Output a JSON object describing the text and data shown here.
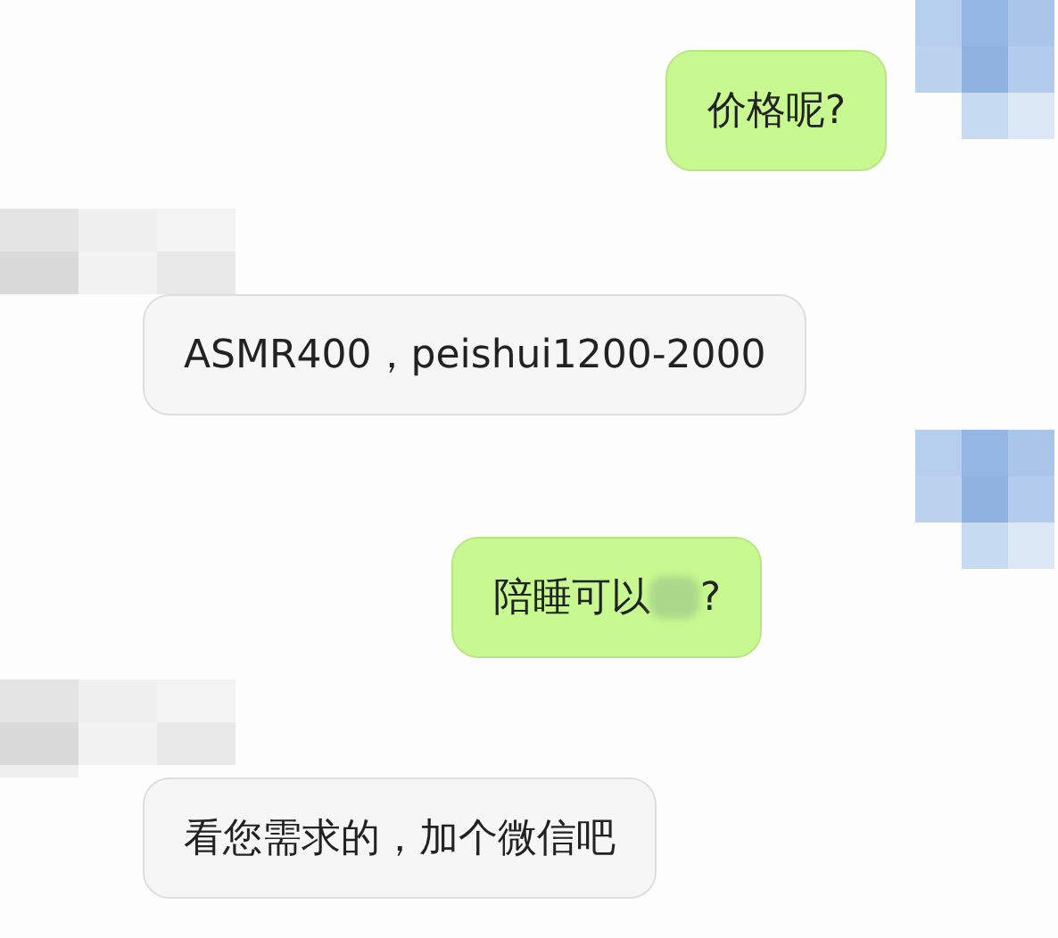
{
  "messages": [
    {
      "kind": "outgoing",
      "parts": [
        {
          "kind": "text",
          "text": "价格呢?"
        }
      ]
    },
    {
      "kind": "incoming",
      "parts": [
        {
          "kind": "text",
          "text": "ASMR400，peishui1200-2000"
        }
      ]
    },
    {
      "kind": "outgoing",
      "parts": [
        {
          "kind": "text",
          "text": "陪睡可以"
        },
        {
          "kind": "redaction"
        },
        {
          "kind": "text",
          "text": "?"
        }
      ]
    },
    {
      "kind": "incoming",
      "parts": [
        {
          "kind": "text",
          "text": "看您需求的，加个微信吧"
        }
      ]
    }
  ]
}
